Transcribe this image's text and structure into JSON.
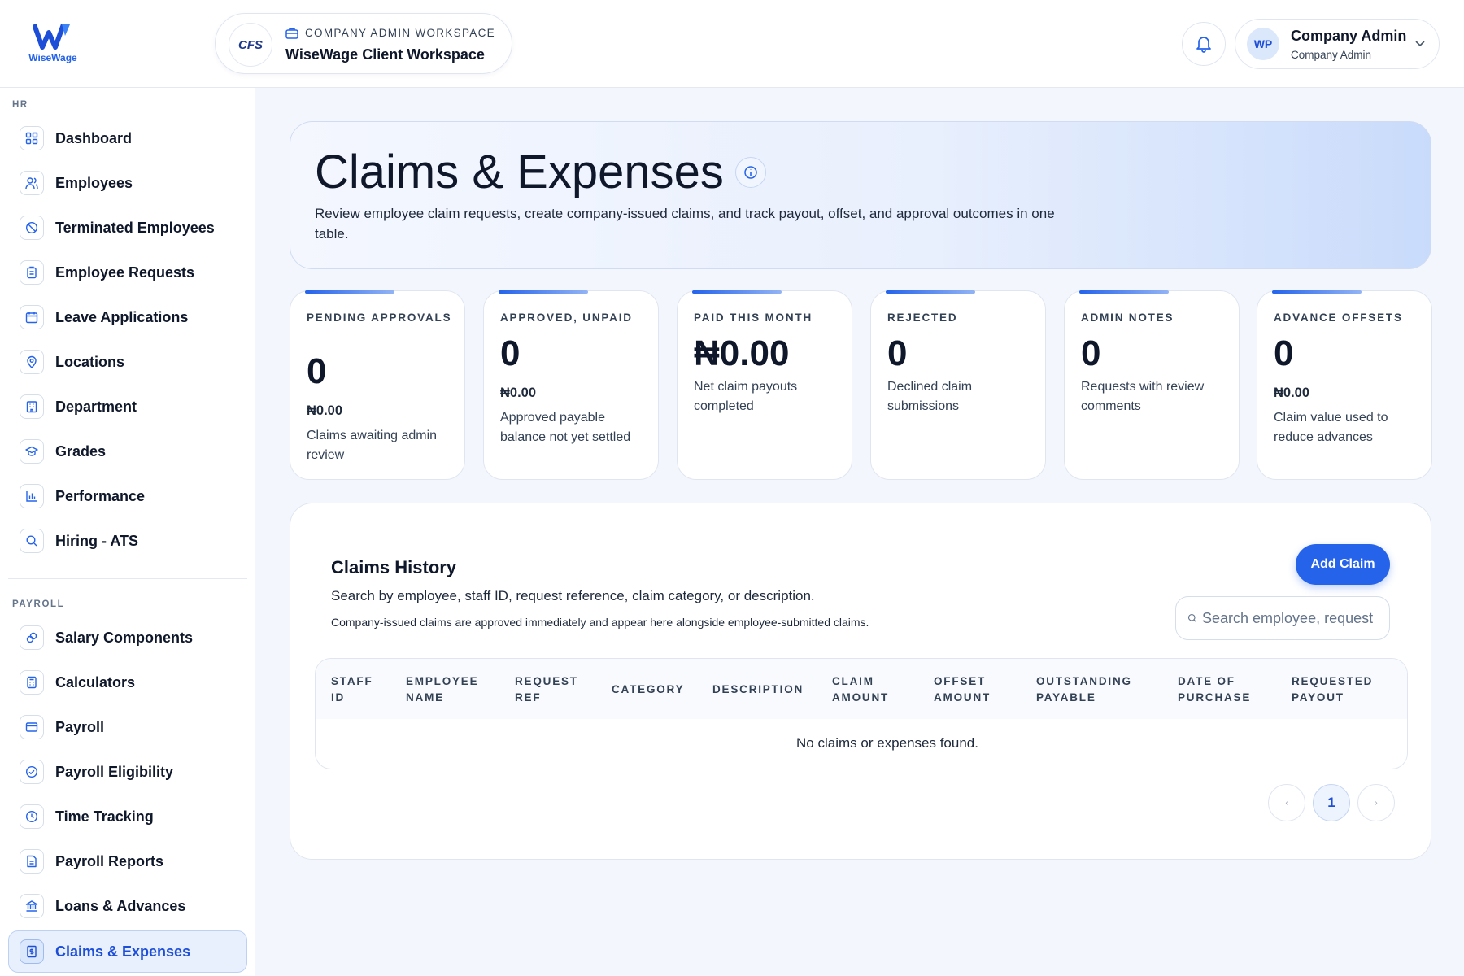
{
  "brand": {
    "name": "WiseWage",
    "accent": "#2563eb"
  },
  "workspace": {
    "label": "COMPANY ADMIN WORKSPACE",
    "title": "WiseWage Client Workspace",
    "logo_text": "CFS"
  },
  "user": {
    "initials": "WP",
    "name": "Company Admin",
    "role": "Company Admin"
  },
  "sidebar": {
    "hr_label": "HR",
    "payroll_label": "PAYROLL",
    "hr_items": [
      {
        "label": "Dashboard",
        "icon": "grid-icon"
      },
      {
        "label": "Employees",
        "icon": "users-icon"
      },
      {
        "label": "Terminated Employees",
        "icon": "slash-icon"
      },
      {
        "label": "Employee Requests",
        "icon": "clipboard-icon"
      },
      {
        "label": "Leave Applications",
        "icon": "calendar-icon"
      },
      {
        "label": "Locations",
        "icon": "map-pin-icon"
      },
      {
        "label": "Department",
        "icon": "building-icon"
      },
      {
        "label": "Grades",
        "icon": "graduation-cap-icon"
      },
      {
        "label": "Performance",
        "icon": "bar-chart-icon"
      },
      {
        "label": "Hiring - ATS",
        "icon": "search-icon"
      }
    ],
    "payroll_items": [
      {
        "label": "Salary Components",
        "icon": "link-icon"
      },
      {
        "label": "Calculators",
        "icon": "calculator-icon"
      },
      {
        "label": "Payroll",
        "icon": "credit-card-icon"
      },
      {
        "label": "Payroll Eligibility",
        "icon": "check-circle-icon"
      },
      {
        "label": "Time Tracking",
        "icon": "clock-icon"
      },
      {
        "label": "Payroll Reports",
        "icon": "file-text-icon"
      },
      {
        "label": "Loans & Advances",
        "icon": "bank-icon"
      },
      {
        "label": "Claims & Expenses",
        "icon": "receipt-icon",
        "active": true
      }
    ]
  },
  "hero": {
    "title": "Claims & Expenses",
    "description": "Review employee claim requests, create company-issued claims, and track payout, offset, and approval outcomes in one table."
  },
  "stats": [
    {
      "label": "PENDING APPROVALS",
      "value": "0",
      "amount": "₦0.00",
      "desc": "Claims awaiting admin review"
    },
    {
      "label": "APPROVED, UNPAID",
      "value": "0",
      "amount": "₦0.00",
      "desc": "Approved payable balance not yet settled"
    },
    {
      "label": "PAID THIS MONTH",
      "value": "₦0.00",
      "amount": "",
      "desc": "Net claim payouts completed"
    },
    {
      "label": "REJECTED",
      "value": "0",
      "amount": "",
      "desc": "Declined claim submissions"
    },
    {
      "label": "ADMIN NOTES",
      "value": "0",
      "amount": "",
      "desc": "Requests with review comments"
    },
    {
      "label": "ADVANCE OFFSETS",
      "value": "0",
      "amount": "₦0.00",
      "desc": "Claim value used to reduce advances"
    }
  ],
  "claims": {
    "title": "Claims History",
    "subtitle": "Search by employee, staff ID, request reference, claim category, or description.",
    "note": "Company-issued claims are approved immediately and appear here alongside employee-submitted claims.",
    "add_label": "Add Claim",
    "search_placeholder": "Search employee, request",
    "columns": [
      {
        "line1": "STAFF",
        "line2": "ID"
      },
      {
        "line1": "EMPLOYEE",
        "line2": "NAME"
      },
      {
        "line1": "REQUEST",
        "line2": "REF"
      },
      {
        "line1": "CATEGORY",
        "line2": ""
      },
      {
        "line1": "DESCRIPTION",
        "line2": ""
      },
      {
        "line1": "CLAIM",
        "line2": "AMOUNT"
      },
      {
        "line1": "OFFSET",
        "line2": "AMOUNT"
      },
      {
        "line1": "OUTSTANDING",
        "line2": "PAYABLE"
      },
      {
        "line1": "DATE OF",
        "line2": "PURCHASE"
      },
      {
        "line1": "REQUESTED",
        "line2": "PAYOUT"
      }
    ],
    "empty": "No claims or expenses found.",
    "pagination": {
      "prev": "‹",
      "current": "1",
      "next": "›"
    }
  }
}
